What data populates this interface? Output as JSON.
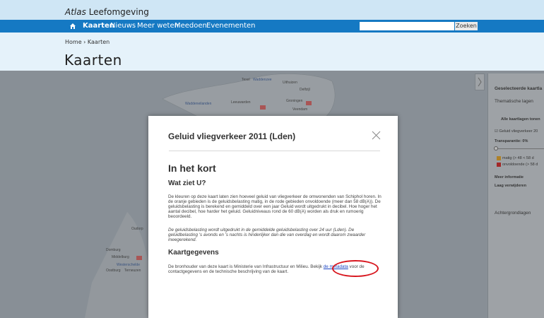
{
  "brand": {
    "part1": "Atlas",
    "part2": "Leefomgeving"
  },
  "nav": {
    "items": [
      "Kaarten",
      "Nieuws",
      "Meer weten",
      "Meedoen",
      "Evenementen"
    ],
    "active": "Kaarten"
  },
  "search": {
    "placeholder": "",
    "button_label": "Zoeken"
  },
  "breadcrumb": {
    "home": "Home",
    "separator": "›",
    "current": "Kaarten"
  },
  "page_title": "Kaarten",
  "map": {
    "labels": [
      "Texel",
      "Waddenzee",
      "Uithuizen",
      "Delfzijl",
      "Waddeneilanden",
      "Leeuwarden",
      "Groningen",
      "Veendam",
      "Oudorp",
      "Domburg",
      "Middelburg",
      "Westerschelde",
      "Oostburg",
      "Terneuzen"
    ]
  },
  "side_panel": {
    "heading": "Geselecteerde kaartla",
    "thematic_layers": "Thematische lagen",
    "show_all_button": "Alle kaartlagen tonen",
    "layer_name": "Geluid vliegverkeer 20",
    "transparency": "Transparantie: 0%",
    "legend": [
      {
        "label": "matig (> 48 < 58 d",
        "color": "#e0a020"
      },
      {
        "label": "onvoldoende (> 58 d",
        "color": "#d02020"
      }
    ],
    "more_info": "Meer informatie",
    "remove_layer": "Laag verwijderen",
    "background_maps": "Achtergrondlagen"
  },
  "modal": {
    "title": "Geluid vliegverkeer 2011 (Lden)",
    "section_heading": "In het kort",
    "question_heading": "Wat ziet U?",
    "paragraph1": "De kleuren op deze kaart laten zien hoeveel geluid van vliegverkeer de omwonenden van Schiphol horen. In de oranje gebieden is de geluidsbelasting matig, in de rode gebieden onvoldoende (meer dan 58 dB(A)). De geluidsbelasting is berekend en gemiddeld over een jaar Geluid wordt uitgedrukt in decibel. Hoe hoger het aantal decibel, hoe harder het geluid. Geluidniveaus rond de 60 dB(A) worden als druk en rumoerig beoordeeld.",
    "paragraph2": "De geluidsbelasting wordt uitgedrukt in de gemiddelde geluidsbelasting over 24 uur (Lden). De geluidbelasting 's avonds en 's nachts is hinderlijker dan die van overdag en wordt daarom zwaarder meegerekend.",
    "data_heading": "Kaartgegevens",
    "paragraph3_before": "De bronhouder van deze kaart is Ministerie van Infrastructuur en Milieu. Bekijk ",
    "metadata_link": "de metadata",
    "paragraph3_after": " voor de contactgegevens en de technische beschrijving van de kaart."
  },
  "colors": {
    "nav_blue": "#1579c3",
    "header_bg": "#e5f2fa",
    "brand_bg": "#cfe6f5",
    "highlight": "#d8171f"
  }
}
